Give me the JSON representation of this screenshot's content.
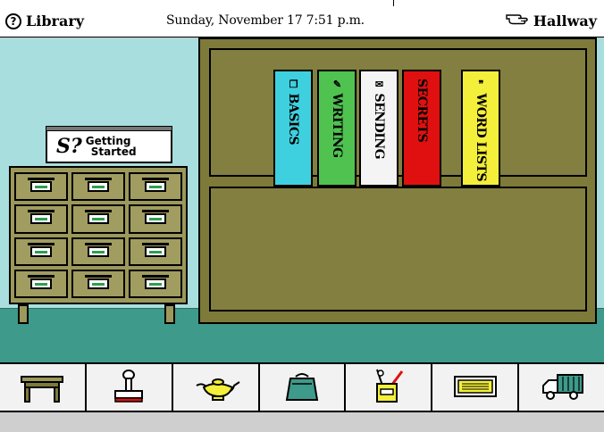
{
  "header": {
    "title": "Library",
    "title_icon": "question-mark-icon",
    "datetime": "Sunday, November 17  7:51 p.m.",
    "exit_label": "Hallway",
    "exit_icon": "pointing-hand-icon"
  },
  "sign": {
    "line1": "Getting",
    "line2": "Started",
    "glyph": "S?"
  },
  "books": [
    {
      "label": "BASICS",
      "color": "#3fd0df",
      "text_color": "#000000",
      "glyph": "❐"
    },
    {
      "label": "WRITING",
      "color": "#4fc24f",
      "text_color": "#000000",
      "glyph": "✎"
    },
    {
      "label": "SENDING",
      "color": "#f4f4f4",
      "text_color": "#000000",
      "glyph": "✉"
    },
    {
      "label": "SECRETS",
      "color": "#e01010",
      "text_color": "#000000",
      "glyph": ""
    },
    {
      "label": "WORD LISTS",
      "color": "#f4ef3a",
      "text_color": "#000000",
      "glyph": "❞"
    }
  ],
  "cabinet": {
    "rows": 4,
    "cols": 3
  },
  "dock": [
    {
      "name": "desk-icon"
    },
    {
      "name": "stamp-icon"
    },
    {
      "name": "magic-lamp-icon"
    },
    {
      "name": "bag-icon"
    },
    {
      "name": "pencil-cup-icon"
    },
    {
      "name": "keyboard-icon"
    },
    {
      "name": "truck-icon"
    }
  ],
  "colors": {
    "wall": "#a9dede",
    "floor": "#3e9a8a",
    "wood": "#7e7a3a"
  }
}
